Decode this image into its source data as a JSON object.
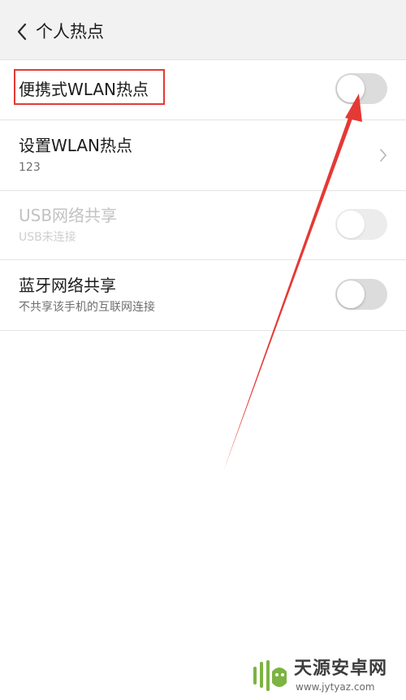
{
  "header": {
    "title": "个人热点",
    "back_icon": "chevron-left-icon"
  },
  "rows": [
    {
      "title": "便携式WLAN热点",
      "toggle": "off",
      "enabled": true
    },
    {
      "title": "设置WLAN热点",
      "subtitle": "123",
      "trailing": "chevron-right-icon"
    },
    {
      "title": "USB网络共享",
      "subtitle": "USB未连接",
      "toggle": "off",
      "enabled": false
    },
    {
      "title": "蓝牙网络共享",
      "subtitle": "不共享该手机的互联网连接",
      "toggle": "off",
      "enabled": true
    }
  ],
  "annotation": {
    "color": "#e53935",
    "highlight": "便携式WLAN热点",
    "arrow_target": "portable-wlan-hotspot-toggle"
  },
  "watermark": {
    "name": "天源安卓网",
    "url": "www.jytyaz.com"
  }
}
